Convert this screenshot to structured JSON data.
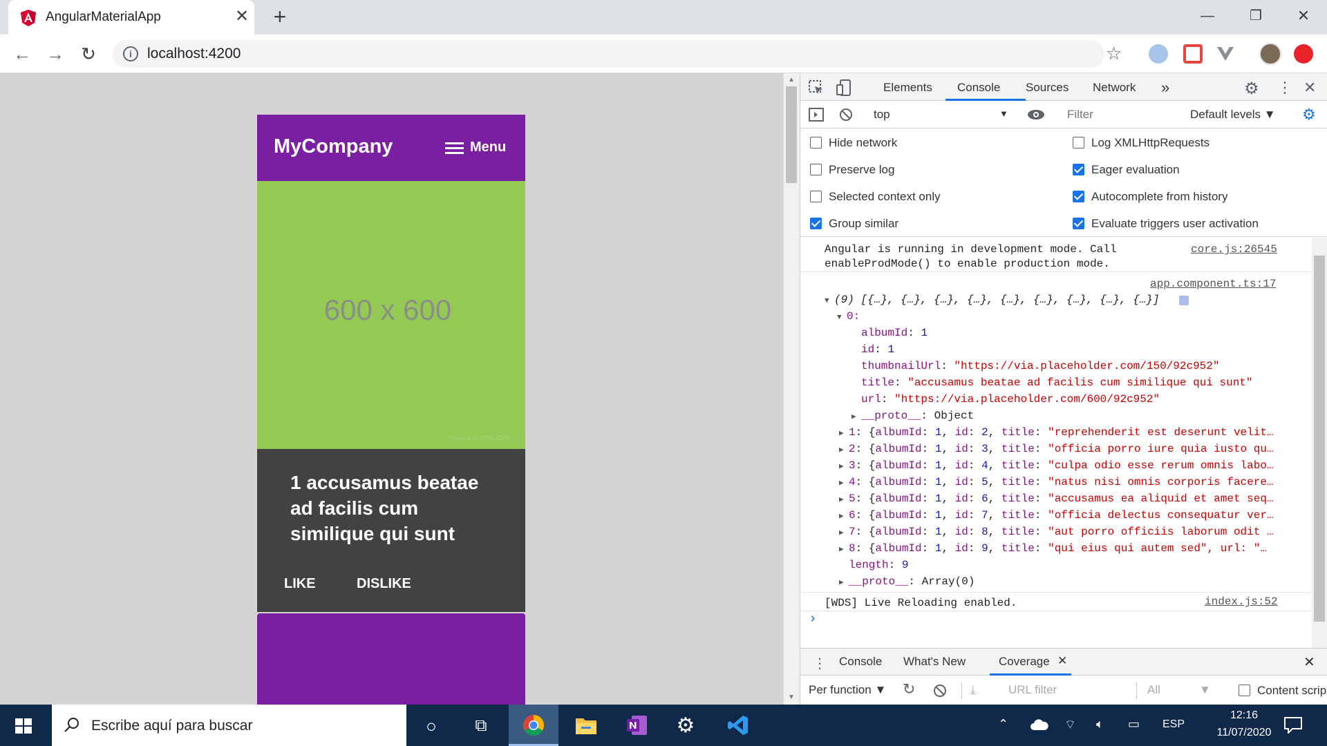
{
  "browser": {
    "tab_title": "AngularMaterialApp",
    "tab_close": "✕",
    "new_tab": "+",
    "url": "localhost:4200",
    "back": "←",
    "forward": "→",
    "reload": "↻",
    "info": "i",
    "star": "☆",
    "win_min": "—",
    "win_max": "❐",
    "win_close": "✕"
  },
  "app": {
    "brand": "MyCompany",
    "menu_label": "Menu",
    "image_label": "600 x 600",
    "image_credit": "Powered by HTML.COM",
    "card_title": "1 accusamus beatae ad facilis cum similique qui sunt",
    "like": "LIKE",
    "dislike": "DISLIKE"
  },
  "devtools": {
    "tabs": [
      "Elements",
      "Console",
      "Sources",
      "Network"
    ],
    "more": "»",
    "context": "top",
    "filter_placeholder": "Filter",
    "levels": "Default levels ▼",
    "settings": [
      {
        "label": "Hide network",
        "checked": false
      },
      {
        "label": "Log XMLHttpRequests",
        "checked": false
      },
      {
        "label": "Preserve log",
        "checked": false
      },
      {
        "label": "Eager evaluation",
        "checked": true
      },
      {
        "label": "Selected context only",
        "checked": false
      },
      {
        "label": "Autocomplete from history",
        "checked": true
      },
      {
        "label": "Group similar",
        "checked": true
      },
      {
        "label": "Evaluate triggers user activation",
        "checked": true
      }
    ],
    "console": {
      "msg1_line1": "Angular is running in development mode. Call",
      "msg1_line2": "enableProdMode() to enable production mode.",
      "msg1_src": "core.js:26545",
      "msg2_src": "app.component.ts:17",
      "array_summary": "(9) [{…}, {…}, {…}, {…}, {…}, {…}, {…}, {…}, {…}]",
      "item0_key": "0:",
      "props": [
        {
          "key": "albumId",
          "value": "1",
          "kind": "num"
        },
        {
          "key": "id",
          "value": "1",
          "kind": "num"
        },
        {
          "key": "thumbnailUrl",
          "value": "\"https://via.placeholder.com/150/92c952\"",
          "kind": "string"
        },
        {
          "key": "title",
          "value": "\"accusamus beatae ad facilis cum similique qui sunt\"",
          "kind": "string"
        },
        {
          "key": "url",
          "value": "\"https://via.placeholder.com/600/92c952\"",
          "kind": "string"
        }
      ],
      "proto_object": "Object",
      "rows": [
        {
          "idx": "1",
          "id": "2",
          "title": "\"reprehenderit est deserunt velit…"
        },
        {
          "idx": "2",
          "id": "3",
          "title": "\"officia porro iure quia iusto qu…"
        },
        {
          "idx": "3",
          "id": "4",
          "title": "\"culpa odio esse rerum omnis labo…"
        },
        {
          "idx": "4",
          "id": "5",
          "title": "\"natus nisi omnis corporis facere…"
        },
        {
          "idx": "5",
          "id": "6",
          "title": "\"accusamus ea aliquid et amet seq…"
        },
        {
          "idx": "6",
          "id": "7",
          "title": "\"officia delectus consequatur ver…"
        },
        {
          "idx": "7",
          "id": "8",
          "title": "\"aut porro officiis laborum odit …"
        },
        {
          "idx": "8",
          "id": "9",
          "title": "\"qui eius qui autem sed\", url: \"…"
        }
      ],
      "length_key": "length",
      "length_value": "9",
      "proto_array": "Array(0)",
      "wds": "[WDS] Live Reloading enabled.",
      "wds_src": "index.js:52",
      "prompt": "›"
    },
    "drawer_tabs": [
      "Console",
      "What's New",
      "Coverage"
    ],
    "drawer_tool": {
      "per_function": "Per function",
      "url_filter": "URL filter",
      "all": "All",
      "content_scripts": "Content scrip"
    }
  },
  "taskbar": {
    "search_placeholder": "Escribe aquí para buscar",
    "lang": "ESP",
    "time": "12:16",
    "date": "11/07/2020"
  }
}
